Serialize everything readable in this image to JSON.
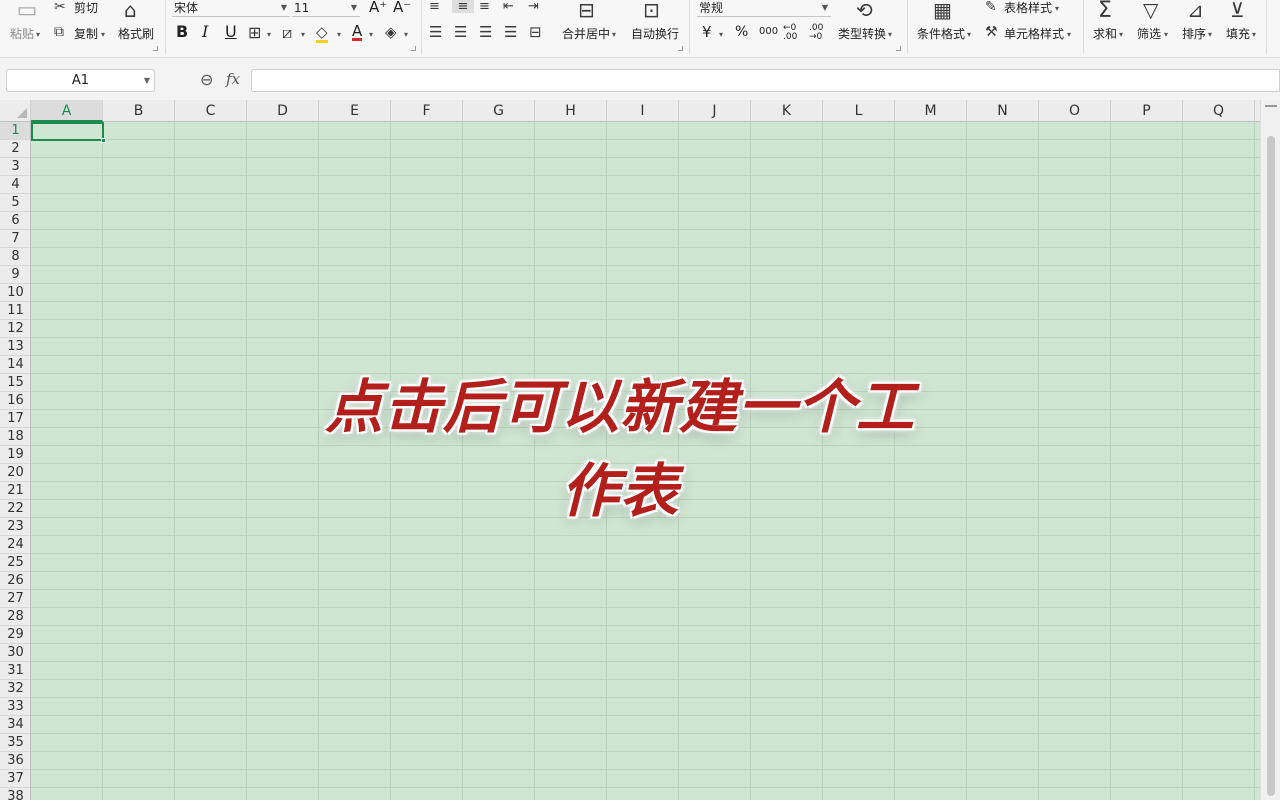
{
  "ribbon": {
    "clipboard": {
      "paste_label": "粘贴",
      "cut_label": "剪切",
      "copy_label": "复制",
      "format_painter_label": "格式刷"
    },
    "font": {
      "family": "宋体",
      "size": "11",
      "grow_label": "A⁺",
      "shrink_label": "A⁻",
      "bold": "B",
      "italic": "I",
      "underline": "U",
      "font_color_label": "A"
    },
    "alignment": {
      "merge_label": "合并居中",
      "wrap_label": "自动换行"
    },
    "number": {
      "format": "常规",
      "currency_symbol": "¥",
      "percent_symbol": "%",
      "thousands_symbol": "000",
      "inc_decimal": "←0 .00",
      "dec_decimal": ".00 →0",
      "type_convert_label": "类型转换"
    },
    "styles": {
      "conditional_label": "条件格式",
      "table_style_label": "表格样式",
      "cell_style_label": "单元格样式"
    },
    "editing": {
      "sum_label": "求和",
      "filter_label": "筛选",
      "sort_label": "排序",
      "fill_label": "填充"
    }
  },
  "formula_bar": {
    "name_box_value": "A1",
    "fx_label": "fx",
    "formula_value": ""
  },
  "sheet": {
    "columns": [
      "A",
      "B",
      "C",
      "D",
      "E",
      "F",
      "G",
      "H",
      "I",
      "J",
      "K",
      "L",
      "M",
      "N",
      "O",
      "P",
      "Q"
    ],
    "rows": [
      "1",
      "2",
      "3",
      "4",
      "5",
      "6",
      "7",
      "8",
      "9",
      "10",
      "11",
      "12",
      "13",
      "14",
      "15",
      "16",
      "17",
      "18",
      "19",
      "20",
      "21",
      "22",
      "23",
      "24",
      "25",
      "26",
      "27",
      "28",
      "29",
      "30",
      "31",
      "32",
      "33",
      "34",
      "35",
      "36",
      "37",
      "38"
    ],
    "active_cell": "A1"
  },
  "overlay": {
    "caption": "点击后可以新建一个工作表"
  },
  "colors": {
    "grid_bg": "#cfe6d2",
    "selection": "#1e8a4c",
    "caption": "#b3201c"
  },
  "icons": [
    "paste-icon",
    "cut-icon",
    "copy-icon",
    "format-painter-icon",
    "border-icon",
    "fill-color-icon",
    "eraser-icon",
    "merge-icon",
    "wrap-icon",
    "convert-icon",
    "conditional-format-icon",
    "table-style-icon",
    "cell-style-icon",
    "sum-icon",
    "filter-icon",
    "sort-icon",
    "fill-down-icon",
    "zoom-icon"
  ]
}
